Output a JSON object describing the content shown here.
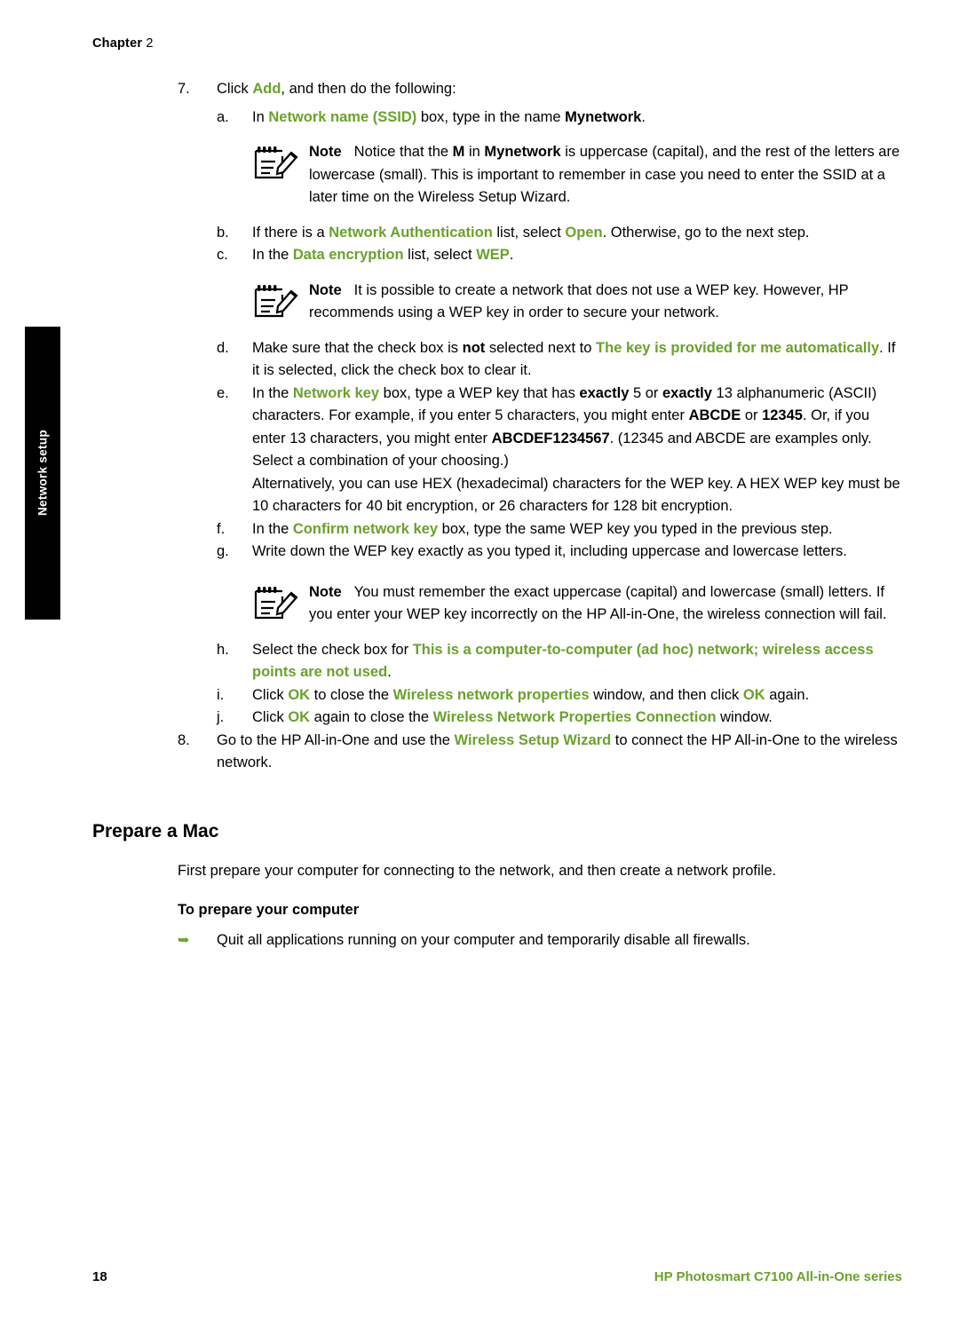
{
  "header": {
    "chapter_label": "Chapter",
    "chapter_number": "2"
  },
  "side_tab": {
    "label": "Network setup"
  },
  "colors": {
    "accent_green": "#6aa12c",
    "text": "#000000",
    "tab_background": "#000000"
  },
  "steps": {
    "step7": {
      "number": "7.",
      "text_before": "Click ",
      "link": "Add",
      "text_after": ", and then do the following:"
    },
    "a": {
      "marker": "a.",
      "p1": "In ",
      "g1": "Network name (SSID)",
      "p2": " box, type in the name ",
      "b1": "Mynetwork",
      "p3": "."
    },
    "note1": {
      "label": "Note",
      "p1": "Notice that the ",
      "b1": "M",
      "p2": " in ",
      "b2": "Mynetwork",
      "p3": " is uppercase (capital), and the rest of the letters are lowercase (small). This is important to remember in case you need to enter the SSID at a later time on the Wireless Setup Wizard."
    },
    "b": {
      "marker": "b.",
      "p1": "If there is a ",
      "g1": "Network Authentication",
      "p2": " list, select ",
      "g2": "Open",
      "p3": ". Otherwise, go to the next step."
    },
    "c": {
      "marker": "c.",
      "p1": "In the ",
      "g1": "Data encryption",
      "p2": " list, select ",
      "g2": "WEP",
      "p3": "."
    },
    "note2": {
      "label": "Note",
      "p1": "It is possible to create a network that does not use a WEP key. However, HP recommends using a WEP key in order to secure your network."
    },
    "d": {
      "marker": "d.",
      "p1": "Make sure that the check box is ",
      "b1": "not",
      "p2": " selected next to ",
      "g1": "The key is provided for me automatically",
      "p3": ". If it is selected, click the check box to clear it."
    },
    "e": {
      "marker": "e.",
      "p1": "In the ",
      "g1": "Network key",
      "p2": " box, type a WEP key that has ",
      "b1": "exactly",
      "p3": " 5 or ",
      "b2": "exactly",
      "p4": " 13 alphanumeric (ASCII) characters. For example, if you enter 5 characters, you might enter ",
      "b3": "ABCDE",
      "p5": " or ",
      "b4": "12345",
      "p6": ". Or, if you enter 13 characters, you might enter ",
      "b5": "ABCDEF1234567",
      "p7": ". (12345 and ABCDE are examples only. Select a combination of your choosing.)",
      "p8": "Alternatively, you can use HEX (hexadecimal) characters for the WEP key. A HEX WEP key must be 10 characters for 40 bit encryption, or 26 characters for 128 bit encryption."
    },
    "f": {
      "marker": "f.",
      "p1": "In the ",
      "g1": "Confirm network key",
      "p2": " box, type the same WEP key you typed in the previous step."
    },
    "g": {
      "marker": "g.",
      "p1": "Write down the WEP key exactly as you typed it, including uppercase and lowercase letters."
    },
    "note3": {
      "label": "Note",
      "p1": "You must remember the exact uppercase (capital) and lowercase (small) letters. If you enter your WEP key incorrectly on the HP All-in-One, the wireless connection will fail."
    },
    "h": {
      "marker": "h.",
      "p1": "Select the check box for ",
      "g1": "This is a computer-to-computer (ad hoc) network; wireless access points are not used",
      "p2": "."
    },
    "i": {
      "marker": "i.",
      "p1": "Click ",
      "g1": "OK",
      "p2": " to close the ",
      "g2": "Wireless network properties",
      "p3": " window, and then click ",
      "g3": "OK",
      "p4": " again."
    },
    "j": {
      "marker": "j.",
      "p1": "Click ",
      "g1": "OK",
      "p2": " again to close the ",
      "g2": "Wireless Network Properties Connection",
      "p3": " window."
    },
    "step8": {
      "number": "8.",
      "p1": "Go to the HP All-in-One and use the ",
      "g1": "Wireless Setup Wizard",
      "p2": " to connect the HP All-in-One to the wireless network."
    }
  },
  "prepare_mac": {
    "heading": "Prepare a Mac",
    "paragraph": "First prepare your computer for connecting to the network, and then create a network profile.",
    "subheading": "To prepare your computer",
    "arrow_item": "Quit all applications running on your computer and temporarily disable all firewalls."
  },
  "footer": {
    "page_number": "18",
    "product_green": "HP Photosmart C7100 All-in-One series"
  }
}
